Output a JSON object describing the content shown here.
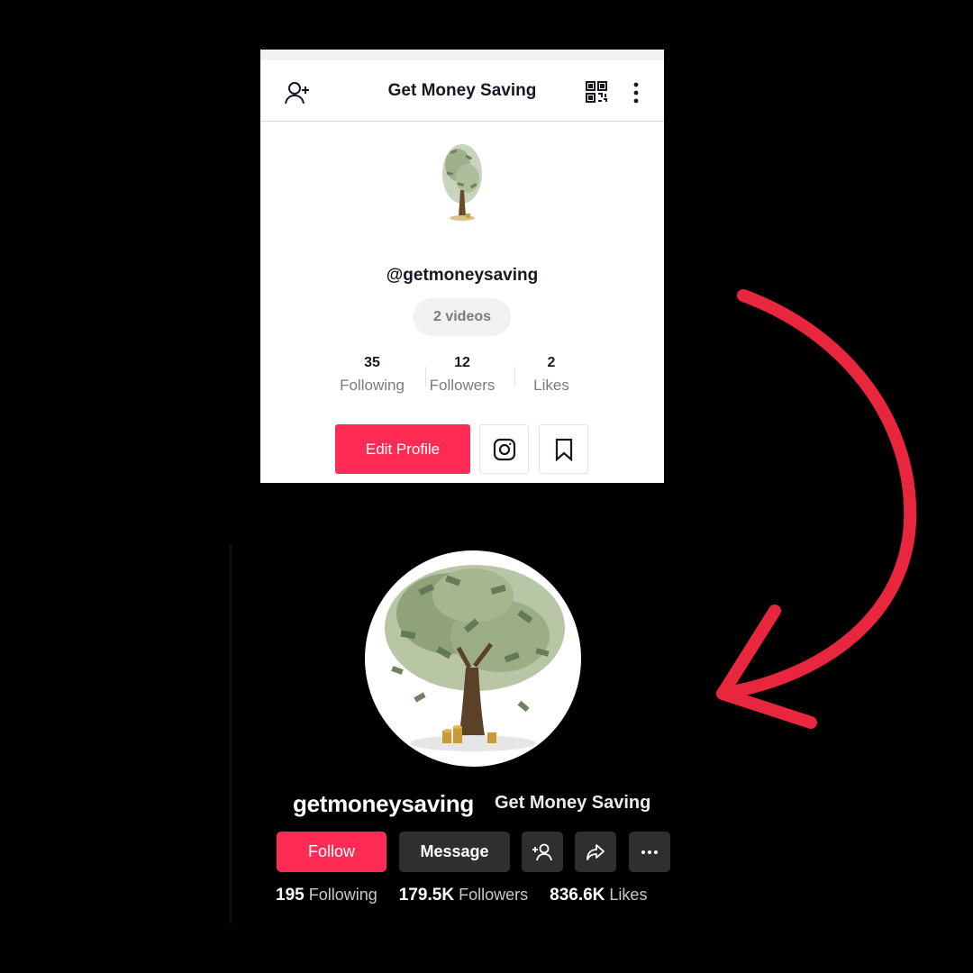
{
  "top_card": {
    "title": "Get Money Saving",
    "handle": "@getmoneysaving",
    "videos_label": "2 videos",
    "stats": [
      {
        "value": "35",
        "label": "Following"
      },
      {
        "value": "12",
        "label": "Followers"
      },
      {
        "value": "2",
        "label": "Likes"
      }
    ],
    "edit_profile_label": "Edit Profile",
    "icons": [
      "add-user-icon",
      "qr-code-icon",
      "more-vertical-icon",
      "instagram-icon",
      "bookmark-icon"
    ]
  },
  "bottom_card": {
    "username": "getmoneysaving",
    "nickname": "Get Money Saving",
    "follow_label": "Follow",
    "message_label": "Message",
    "stats": [
      {
        "value": "195",
        "label": "Following"
      },
      {
        "value": "179.5K",
        "label": "Followers"
      },
      {
        "value": "836.6K",
        "label": "Likes"
      }
    ],
    "icons": [
      "add-friend-icon",
      "share-icon",
      "more-horizontal-icon"
    ]
  },
  "colors": {
    "accent": "#fe2c55",
    "arrow": "#e8273f",
    "dark_button": "#2f2f2f"
  }
}
